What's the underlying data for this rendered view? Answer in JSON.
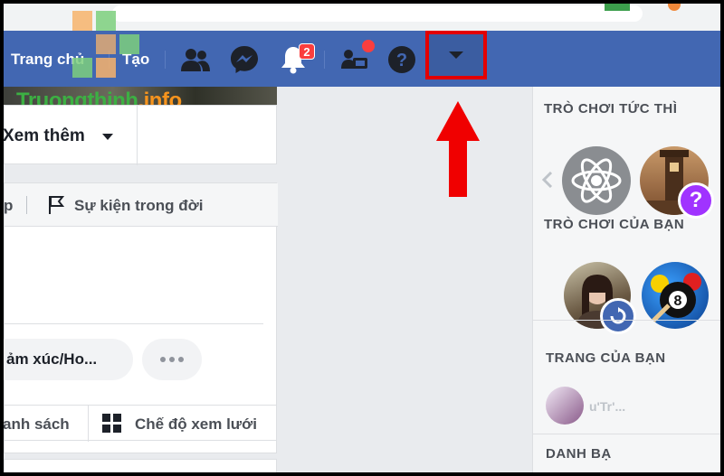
{
  "nav": {
    "home": "Trang chủ",
    "create": "Tạo",
    "notif_count": "2"
  },
  "watermark": {
    "brand_main": "Truongthinh",
    "brand_tld": ".info"
  },
  "left": {
    "see_more": "Xem thêm",
    "tab_partial": "p",
    "life_event": "Sự kiện trong đời",
    "feeling_partial": "ảm xúc/Ho...",
    "list_partial": "anh sách",
    "grid_view": "Chế độ xem lưới"
  },
  "sidebar": {
    "instant_games": "TRÒ CHƠI TỨC THÌ",
    "your_games": "TRÒ CHƠI CỦA BẠN",
    "your_pages": "TRANG CỦA BẠN",
    "contacts": "DANH BẠ",
    "page_name": "u'Tr'..."
  },
  "colors": {
    "fb_blue": "#4267b2",
    "highlight_red": "#e30000",
    "watermark_green": "#3cb043",
    "watermark_orange": "#f7941d"
  }
}
